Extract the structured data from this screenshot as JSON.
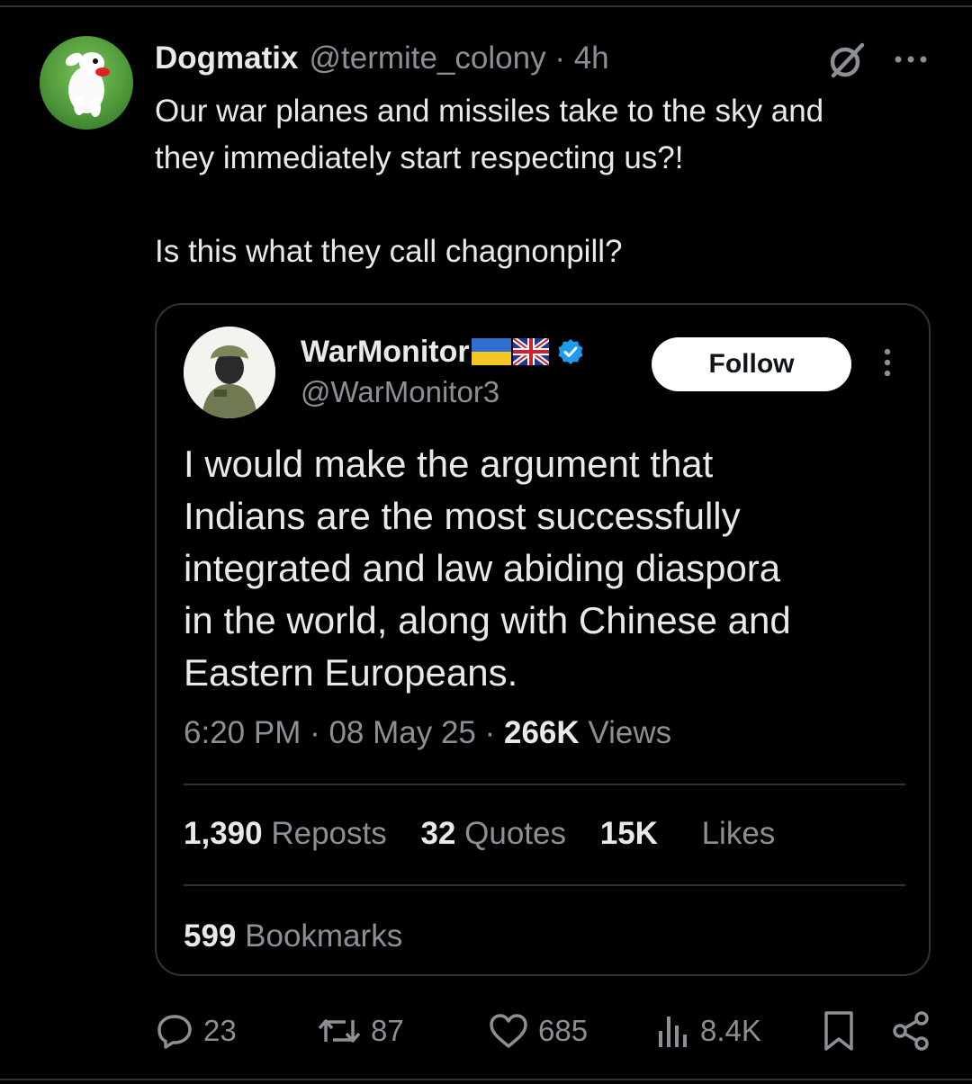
{
  "tweet": {
    "author_name": "Dogmatix",
    "handle_time": "@termite_colony · 4h",
    "text_line1": "Our war planes and missiles take to the sky and",
    "text_line2": "they immediately start respecting us?!",
    "text_line3": "Is this what they call chagnonpill?"
  },
  "quoted": {
    "author_name": "WarMonitor",
    "handle": "@WarMonitor3",
    "follow_label": "Follow",
    "text_lines": [
      "I would make the argument that",
      "Indians are the most successfully",
      "integrated and law abiding diaspora",
      "in the world, along with Chinese and",
      "Eastern Europeans."
    ],
    "time": "6:20 PM · 08 May 25 · ",
    "views_count": "266K",
    "views_label": " Views",
    "reposts_count": "1,390",
    "reposts_label": "Reposts",
    "quotes_count": "32",
    "quotes_label": "Quotes",
    "likes_count": "15K",
    "likes_label": "Likes",
    "bookmarks_count": "599",
    "bookmarks_label": "Bookmarks"
  },
  "actions": {
    "replies": "23",
    "reposts": "87",
    "likes": "685",
    "views": "8.4K"
  },
  "icons": [
    "grok-icon",
    "more-icon",
    "verified-icon",
    "ukraine-flag-icon",
    "uk-flag-icon",
    "reply-icon",
    "repost-icon",
    "like-icon",
    "views-icon",
    "bookmark-icon",
    "share-icon"
  ],
  "colors": {
    "background": "#000000",
    "text": "#e7e9ea",
    "muted": "#8b9095",
    "border": "#2f3336",
    "verified": "#1d9bf0"
  }
}
